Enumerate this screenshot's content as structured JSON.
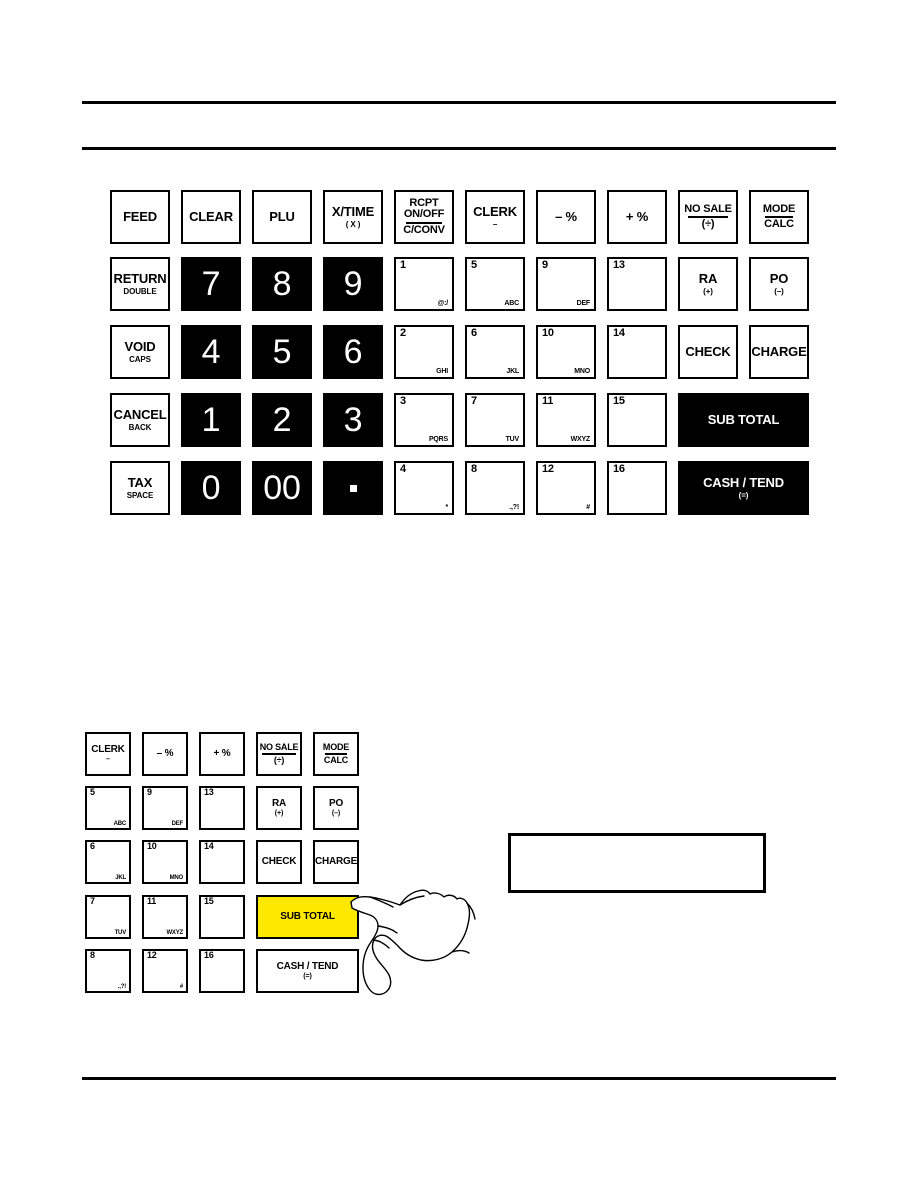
{
  "page": {
    "background_color": "#ffffff",
    "ink_color": "#000000",
    "highlight_color": "#ffe800",
    "rules": [
      {
        "name": "header-rule-upper"
      },
      {
        "name": "header-rule-lower"
      },
      {
        "name": "footer-rule"
      }
    ]
  },
  "main_keyboard": {
    "name": "full-keyboard-diagram",
    "rows": [
      [
        {
          "id": "feed",
          "label": "FEED",
          "style": "light"
        },
        {
          "id": "clear",
          "label": "CLEAR",
          "style": "light"
        },
        {
          "id": "plu",
          "label": "PLU",
          "style": "light"
        },
        {
          "id": "x-time",
          "label": "X/TIME",
          "sub": "( X )",
          "style": "light"
        },
        {
          "id": "rcpt-onoff",
          "line1": "RCPT",
          "line2": "ON/OFF",
          "line3": "C/CONV",
          "style": "light",
          "divided": true
        },
        {
          "id": "clerk",
          "label": "CLERK",
          "sub": "–",
          "style": "light"
        },
        {
          "id": "minus-pct",
          "label": "– %",
          "style": "light"
        },
        {
          "id": "plus-pct",
          "label": "+ %",
          "style": "light"
        },
        {
          "id": "no-sale",
          "line1": "NO SALE",
          "line3": "(÷)",
          "style": "light",
          "divided": true
        },
        {
          "id": "mode-calc",
          "line1": "MODE",
          "line3": "CALC",
          "style": "light",
          "divided": true
        }
      ],
      [
        {
          "id": "return",
          "label": "RETURN",
          "sub": "DOUBLE",
          "style": "light"
        },
        {
          "id": "num-7",
          "label": "7",
          "style": "dark",
          "kind": "numpad"
        },
        {
          "id": "num-8",
          "label": "8",
          "style": "dark",
          "kind": "numpad"
        },
        {
          "id": "num-9",
          "label": "9",
          "style": "dark",
          "kind": "numpad"
        },
        {
          "id": "dept-1",
          "number": "1",
          "letters": "@:/",
          "style": "light",
          "kind": "dept"
        },
        {
          "id": "dept-5",
          "number": "5",
          "letters": "ABC",
          "style": "light",
          "kind": "dept"
        },
        {
          "id": "dept-9",
          "number": "9",
          "letters": "DEF",
          "style": "light",
          "kind": "dept"
        },
        {
          "id": "dept-13",
          "number": "13",
          "letters": "",
          "style": "light",
          "kind": "dept"
        },
        {
          "id": "ra",
          "label": "RA",
          "sub": "(+)",
          "style": "light"
        },
        {
          "id": "po",
          "label": "PO",
          "sub": "(–)",
          "style": "light"
        }
      ],
      [
        {
          "id": "void",
          "label": "VOID",
          "sub": "CAPS",
          "style": "light"
        },
        {
          "id": "num-4",
          "label": "4",
          "style": "dark",
          "kind": "numpad"
        },
        {
          "id": "num-5",
          "label": "5",
          "style": "dark",
          "kind": "numpad"
        },
        {
          "id": "num-6",
          "label": "6",
          "style": "dark",
          "kind": "numpad"
        },
        {
          "id": "dept-2",
          "number": "2",
          "letters": "GHI",
          "style": "light",
          "kind": "dept"
        },
        {
          "id": "dept-6",
          "number": "6",
          "letters": "JKL",
          "style": "light",
          "kind": "dept"
        },
        {
          "id": "dept-10",
          "number": "10",
          "letters": "MNO",
          "style": "light",
          "kind": "dept"
        },
        {
          "id": "dept-14",
          "number": "14",
          "letters": "",
          "style": "light",
          "kind": "dept"
        },
        {
          "id": "check",
          "label": "CHECK",
          "style": "light"
        },
        {
          "id": "charge",
          "label": "CHARGE",
          "style": "light"
        }
      ],
      [
        {
          "id": "cancel",
          "label": "CANCEL",
          "sub": "BACK",
          "style": "light"
        },
        {
          "id": "num-1",
          "label": "1",
          "style": "dark",
          "kind": "numpad"
        },
        {
          "id": "num-2",
          "label": "2",
          "style": "dark",
          "kind": "numpad"
        },
        {
          "id": "num-3",
          "label": "3",
          "style": "dark",
          "kind": "numpad"
        },
        {
          "id": "dept-3",
          "number": "3",
          "letters": "PQRS",
          "style": "light",
          "kind": "dept"
        },
        {
          "id": "dept-7",
          "number": "7",
          "letters": "TUV",
          "style": "light",
          "kind": "dept"
        },
        {
          "id": "dept-11",
          "number": "11",
          "letters": "WXYZ",
          "style": "light",
          "kind": "dept"
        },
        {
          "id": "dept-15",
          "number": "15",
          "letters": "",
          "style": "light",
          "kind": "dept"
        },
        {
          "id": "sub-total",
          "label": "SUB TOTAL",
          "style": "dark",
          "kind": "wide"
        }
      ],
      [
        {
          "id": "tax",
          "label": "TAX",
          "sub": "SPACE",
          "style": "light"
        },
        {
          "id": "num-0",
          "label": "0",
          "style": "dark",
          "kind": "numpad"
        },
        {
          "id": "num-00",
          "label": "00",
          "style": "dark",
          "kind": "numpad"
        },
        {
          "id": "num-dot",
          "label": ".",
          "style": "dark",
          "kind": "dot"
        },
        {
          "id": "dept-4",
          "number": "4",
          "letters": "*",
          "style": "light",
          "kind": "dept"
        },
        {
          "id": "dept-8",
          "number": "8",
          "letters": ".,?!",
          "style": "light",
          "kind": "dept"
        },
        {
          "id": "dept-12",
          "number": "12",
          "letters": "#",
          "style": "light",
          "kind": "dept"
        },
        {
          "id": "dept-16",
          "number": "16",
          "letters": "",
          "style": "light",
          "kind": "dept"
        },
        {
          "id": "cash-tend",
          "label": "CASH / TEND",
          "sub": "(=)",
          "style": "dark",
          "kind": "wide"
        }
      ]
    ]
  },
  "detail_keyboard": {
    "name": "keyboard-detail-closeup",
    "rows": [
      [
        {
          "id": "d-clerk",
          "label": "CLERK",
          "sub": "–",
          "style": "light"
        },
        {
          "id": "d-minus-pct",
          "label": "– %",
          "style": "light"
        },
        {
          "id": "d-plus-pct",
          "label": "+ %",
          "style": "light"
        },
        {
          "id": "d-no-sale",
          "line1": "NO SALE",
          "line3": "(÷)",
          "style": "light",
          "divided": true
        },
        {
          "id": "d-mode-calc",
          "line1": "MODE",
          "line3": "CALC",
          "style": "light",
          "divided": true
        }
      ],
      [
        {
          "id": "d-dept-5",
          "number": "5",
          "letters": "ABC",
          "style": "light",
          "kind": "dept"
        },
        {
          "id": "d-dept-9",
          "number": "9",
          "letters": "DEF",
          "style": "light",
          "kind": "dept"
        },
        {
          "id": "d-dept-13",
          "number": "13",
          "letters": "",
          "style": "light",
          "kind": "dept"
        },
        {
          "id": "d-ra",
          "label": "RA",
          "sub": "(+)",
          "style": "light"
        },
        {
          "id": "d-po",
          "label": "PO",
          "sub": "(–)",
          "style": "light"
        }
      ],
      [
        {
          "id": "d-dept-6",
          "number": "6",
          "letters": "JKL",
          "style": "light",
          "kind": "dept"
        },
        {
          "id": "d-dept-10",
          "number": "10",
          "letters": "MNO",
          "style": "light",
          "kind": "dept"
        },
        {
          "id": "d-dept-14",
          "number": "14",
          "letters": "",
          "style": "light",
          "kind": "dept"
        },
        {
          "id": "d-check",
          "label": "CHECK",
          "style": "light"
        },
        {
          "id": "d-charge",
          "label": "CHARGE",
          "style": "light"
        }
      ],
      [
        {
          "id": "d-dept-7",
          "number": "7",
          "letters": "TUV",
          "style": "light",
          "kind": "dept"
        },
        {
          "id": "d-dept-11",
          "number": "11",
          "letters": "WXYZ",
          "style": "light",
          "kind": "dept"
        },
        {
          "id": "d-dept-15",
          "number": "15",
          "letters": "",
          "style": "light",
          "kind": "dept"
        },
        {
          "id": "d-sub-total",
          "label": "SUB TOTAL",
          "style": "highlight",
          "kind": "wide"
        }
      ],
      [
        {
          "id": "d-dept-8",
          "number": "8",
          "letters": ".,?!",
          "style": "light",
          "kind": "dept"
        },
        {
          "id": "d-dept-12",
          "number": "12",
          "letters": "#",
          "style": "light",
          "kind": "dept"
        },
        {
          "id": "d-dept-16",
          "number": "16",
          "letters": "",
          "style": "light",
          "kind": "dept"
        },
        {
          "id": "d-cash-tend",
          "label": "CASH / TEND",
          "sub": "(=)",
          "style": "light",
          "kind": "wide"
        }
      ]
    ]
  },
  "display_box": {
    "name": "display-readout-box",
    "text": ""
  },
  "hand": {
    "name": "pointing-hand-illustration",
    "target_key": "SUB TOTAL"
  }
}
